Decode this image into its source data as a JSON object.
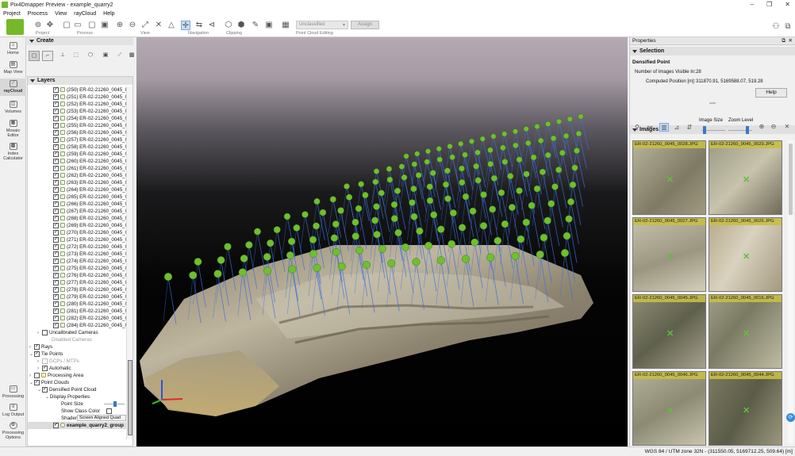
{
  "window": {
    "title": "Pix4Dmapper Preview - example_quarry2"
  },
  "menu": [
    "Project",
    "Process",
    "View",
    "rayCloud",
    "Help"
  ],
  "toolbar": {
    "groups": [
      "Project",
      "Process",
      "View",
      "Navigation",
      "Clipping",
      "Point Cloud Editing"
    ],
    "class_dropdown": "Unclassified",
    "assign_label": "Assign"
  },
  "sidebar": {
    "items": [
      {
        "label": "Home",
        "icon": "home-icon"
      },
      {
        "label": "Map View",
        "icon": "map-icon"
      },
      {
        "label": "rayCloud",
        "icon": "raycloud-icon",
        "active": true
      },
      {
        "label": "Volumes",
        "icon": "volumes-icon"
      },
      {
        "label": "Mosaic Editor",
        "icon": "mosaic-icon"
      },
      {
        "label": "Index Calculator",
        "icon": "index-icon"
      }
    ],
    "bottom": [
      {
        "label": "Processing",
        "icon": "processing-icon"
      },
      {
        "label": "Log Output",
        "icon": "log-icon"
      },
      {
        "label": "Processing Options",
        "icon": "gear-icon"
      }
    ]
  },
  "create": {
    "title": "Create"
  },
  "layers": {
    "title": "Layers",
    "cameras": [
      "(250) ER-02-21260_0045_0",
      "(251) ER-02-21260_0045_0",
      "(252) ER-02-21260_0045_0",
      "(253) ER-02-21260_0045_0",
      "(254) ER-02-21260_0045_0",
      "(255) ER-02-21260_0045_0",
      "(256) ER-02-21260_0045_0",
      "(257) ER-02-21260_0045_0",
      "(258) ER-02-21260_0045_0",
      "(259) ER-02-21260_0045_0",
      "(260) ER-02-21260_0045_0",
      "(261) ER-02-21260_0045_0",
      "(262) ER-02-21260_0045_0",
      "(263) ER-02-21260_0045_0",
      "(264) ER-02-21260_0045_0",
      "(265) ER-02-21260_0045_0",
      "(266) ER-02-21260_0045_0",
      "(267) ER-02-21260_0045_0",
      "(268) ER-02-21260_0045_0",
      "(269) ER-02-21260_0045_0",
      "(270) ER-02-21260_0045_0",
      "(271) ER-02-21260_0045_0",
      "(272) ER-02-21260_0045_0",
      "(273) ER-02-21260_0045_0",
      "(274) ER-02-21260_0045_0",
      "(275) ER-02-21260_0045_0",
      "(276) ER-02-21260_0045_0",
      "(277) ER-02-21260_0045_0",
      "(278) ER-02-21260_0045_0",
      "(279) ER-02-21260_0045_0",
      "(280) ER-02-21260_0045_0",
      "(281) ER-02-21260_0045_0",
      "(282) ER-02-21260_0045_0",
      "(284) ER-02-21260_0045_0"
    ],
    "uncalibrated": "Uncalibrated Cameras",
    "disabled": "Disabled Cameras",
    "rays": "Rays",
    "tie_points": "Tie Points",
    "gcps": "GCPs / MTPs",
    "automatic": "Automatic",
    "processing_area": "Processing Area",
    "point_clouds": "Point Clouds",
    "densified": "Densified Point Cloud",
    "display_props": "Display Properties",
    "point_size": "Point Size",
    "show_class_color": "Show Class Color",
    "shader_label": "Shader",
    "shader_value": "Screen Aligned Quad",
    "group": "example_quarry2_group"
  },
  "properties": {
    "title": "Properties",
    "selection": {
      "title": "Selection",
      "subtitle": "Densified Point",
      "images_label": "Number of Images Visible In:",
      "images_value": "28",
      "position_label": "Computed Position [m]:",
      "position_value": "311870.91, 5169588.07, 519.28",
      "help": "Help"
    },
    "images": {
      "title": "Images",
      "image_size_label": "Image Size",
      "zoom_label": "Zoom Level",
      "thumbnails": [
        "ER-02-21260_0045_0028.JPG",
        "ER-02-21260_0045_0029.JPG",
        "ER-02-21260_0045_0027.JPG",
        "ER-02-21260_0045_0026.JPG",
        "ER-02-21260_0045_0045.JPG",
        "ER-02-21260_0045_0016.JPG",
        "ER-02-21260_0045_0046.JPG",
        "ER-02-21260_0045_0044.JPG"
      ]
    }
  },
  "status": {
    "crs": "WGS 84 / UTM zone 32N - (311550.05, 5169712.25, 509.64) [m]"
  },
  "colors": {
    "accent": "#76b82a",
    "camera_green": "#6fbf2e",
    "ray_blue": "#3a6fe0"
  }
}
